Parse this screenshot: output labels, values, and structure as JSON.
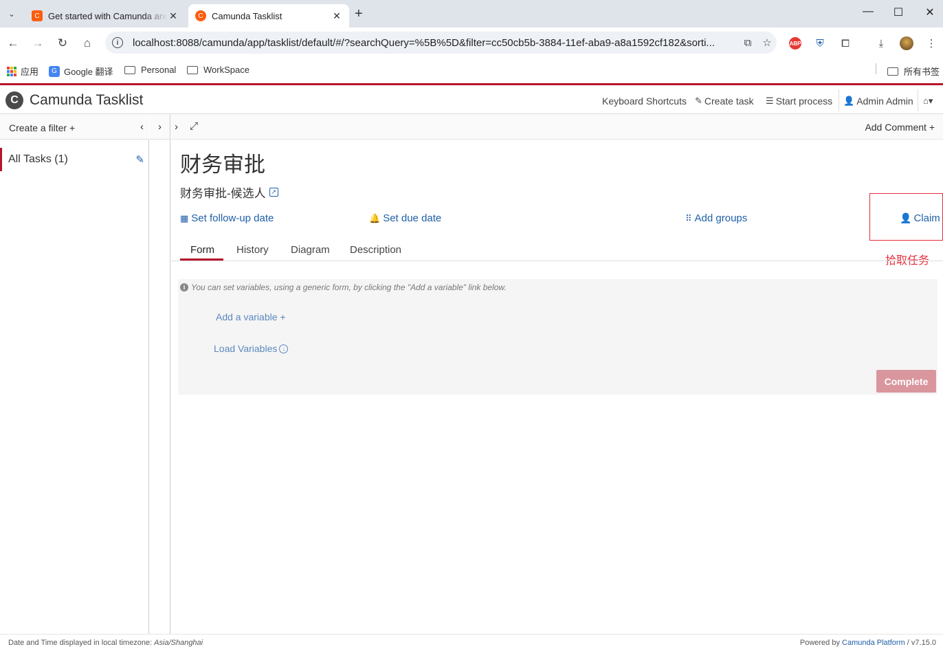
{
  "browser": {
    "tabs": [
      {
        "title": "Get started with Camunda and"
      },
      {
        "title": "Camunda Tasklist"
      }
    ],
    "url": "localhost:8088/camunda/app/tasklist/default/#/?searchQuery=%5B%5D&filter=cc50cb5b-3884-11ef-aba9-a8a1592cf182&sorti...",
    "bookmarks": [
      {
        "label": "应用"
      },
      {
        "label": "Google 翻译"
      },
      {
        "label": "Personal"
      },
      {
        "label": "WorkSpace"
      }
    ],
    "all_bookmarks_label": "所有书签",
    "extension_abp": "ABP"
  },
  "header": {
    "logo_glyph": "C",
    "brand": "Camunda Tasklist",
    "nav": {
      "keyboard_shortcuts": "Keyboard Shortcuts",
      "create_task": "Create task",
      "start_process": "Start process",
      "user": "Admin Admin"
    }
  },
  "sidebar": {
    "create_filter": "Create a filter",
    "filters": [
      {
        "label": "All Tasks (1)"
      }
    ]
  },
  "main": {
    "add_comment": "Add Comment",
    "task_title": "财务审批",
    "task_subtitle": "财务审批-候选人",
    "actions": {
      "follow_up": "Set follow-up date",
      "due_date": "Set due date",
      "add_groups": "Add groups",
      "claim": "Claim"
    },
    "annotation": "拾取任务",
    "tabs": [
      {
        "label": "Form"
      },
      {
        "label": "History"
      },
      {
        "label": "Diagram"
      },
      {
        "label": "Description"
      }
    ],
    "form": {
      "hint": "You can set variables, using a generic form, by clicking the \"Add a variable\" link below.",
      "add_variable": "Add a variable",
      "load_variables": "Load Variables",
      "complete": "Complete"
    }
  },
  "footer": {
    "timezone_prefix": "Date and Time displayed in local timezone: ",
    "timezone": "Asia/Shanghai",
    "powered_by": "Powered by ",
    "platform": "Camunda Platform",
    "version": " / v7.15.0"
  },
  "colors": {
    "brand_red": "#b5152b",
    "link_blue": "#1f5fa8",
    "annotation_red": "#e52b3a",
    "complete_disabled": "#d9969d"
  }
}
